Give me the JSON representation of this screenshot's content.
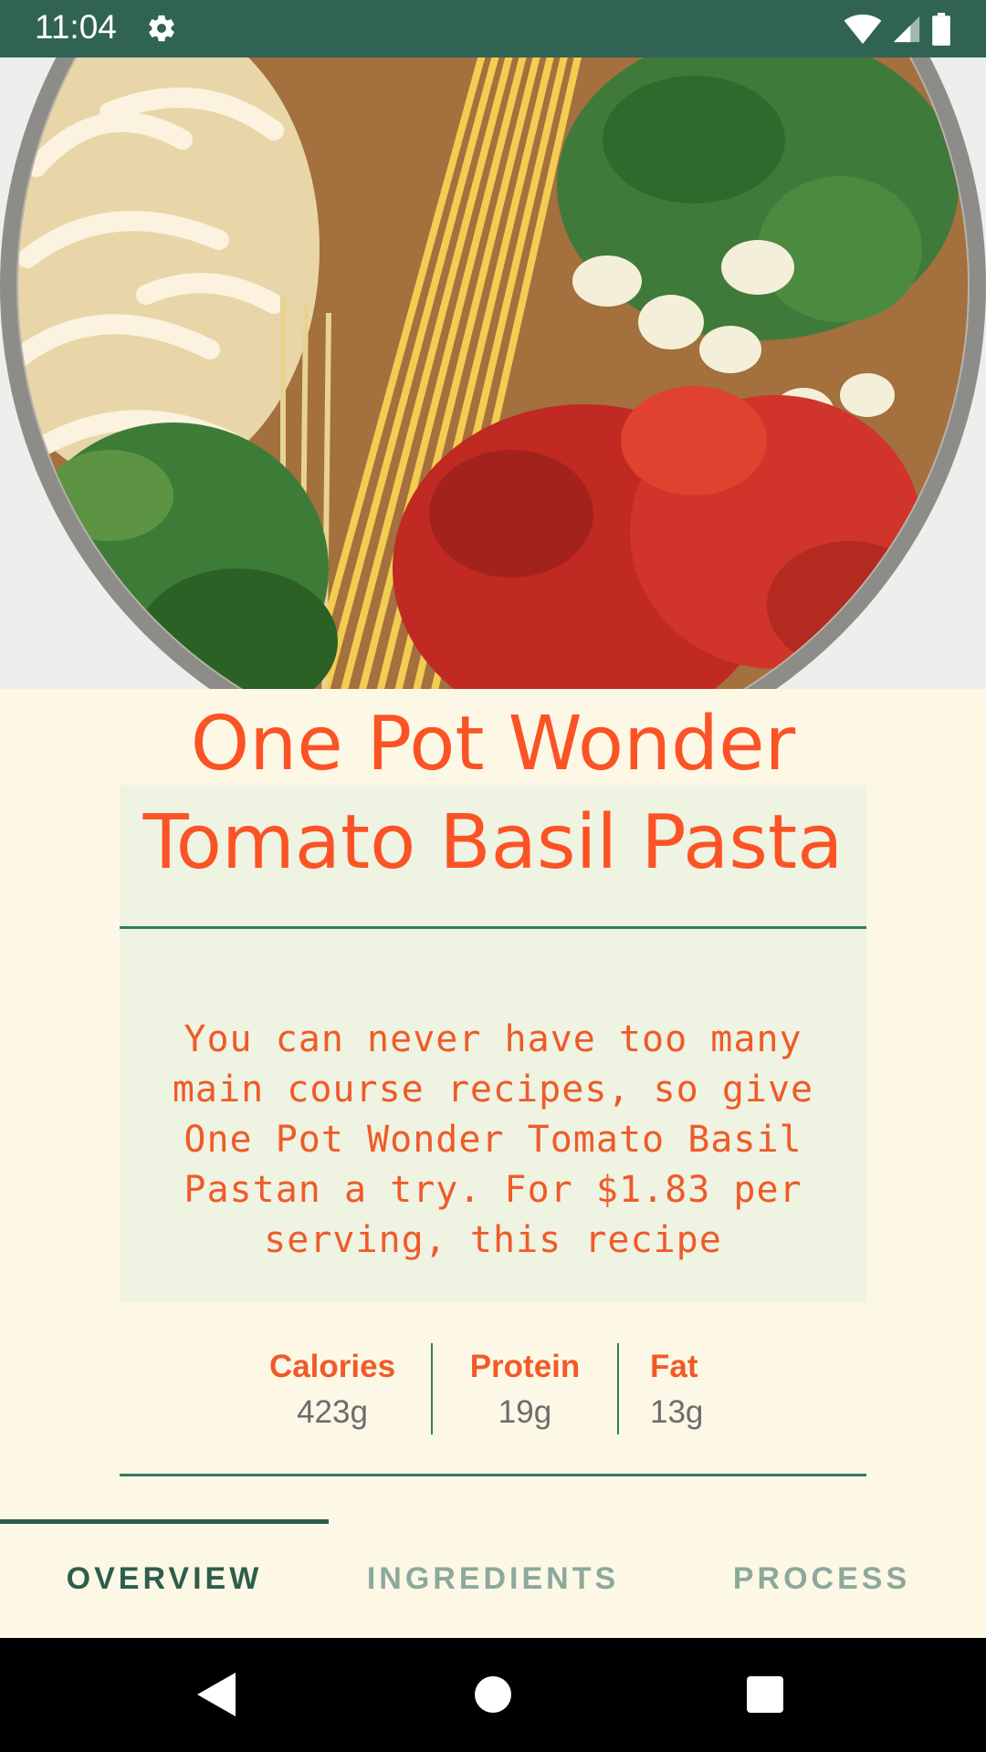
{
  "status_bar": {
    "time": "11:04",
    "icons": [
      "gear-icon",
      "wifi-icon",
      "signal-icon",
      "battery-icon"
    ],
    "background": "#306353"
  },
  "recipe": {
    "title_line1": "One Pot Wonder",
    "title_line2": "Tomato Basil Pasta",
    "summary": "You can never have too many main course recipes, so give One Pot Wonder Tomato Basil Pastan a try. For $1.83 per serving, this recipe",
    "image_alt": "Pot with pasta, onions, basil, garlic and tomatoes"
  },
  "nutrition": [
    {
      "label": "Calories",
      "value": "423g"
    },
    {
      "label": "Protein",
      "value": "19g"
    },
    {
      "label": "Fat",
      "value": "13g"
    }
  ],
  "tabs": [
    {
      "label": "OVERVIEW",
      "active": true
    },
    {
      "label": "INGREDIENTS",
      "active": false
    },
    {
      "label": "PROCESS",
      "active": false
    }
  ],
  "navigation": {
    "icons": [
      "back-icon",
      "home-icon",
      "recents-icon"
    ]
  },
  "colors": {
    "accent": "#fb5325",
    "primary": "#306353",
    "background": "#fdf8e6",
    "panel": "#eef3e2"
  }
}
